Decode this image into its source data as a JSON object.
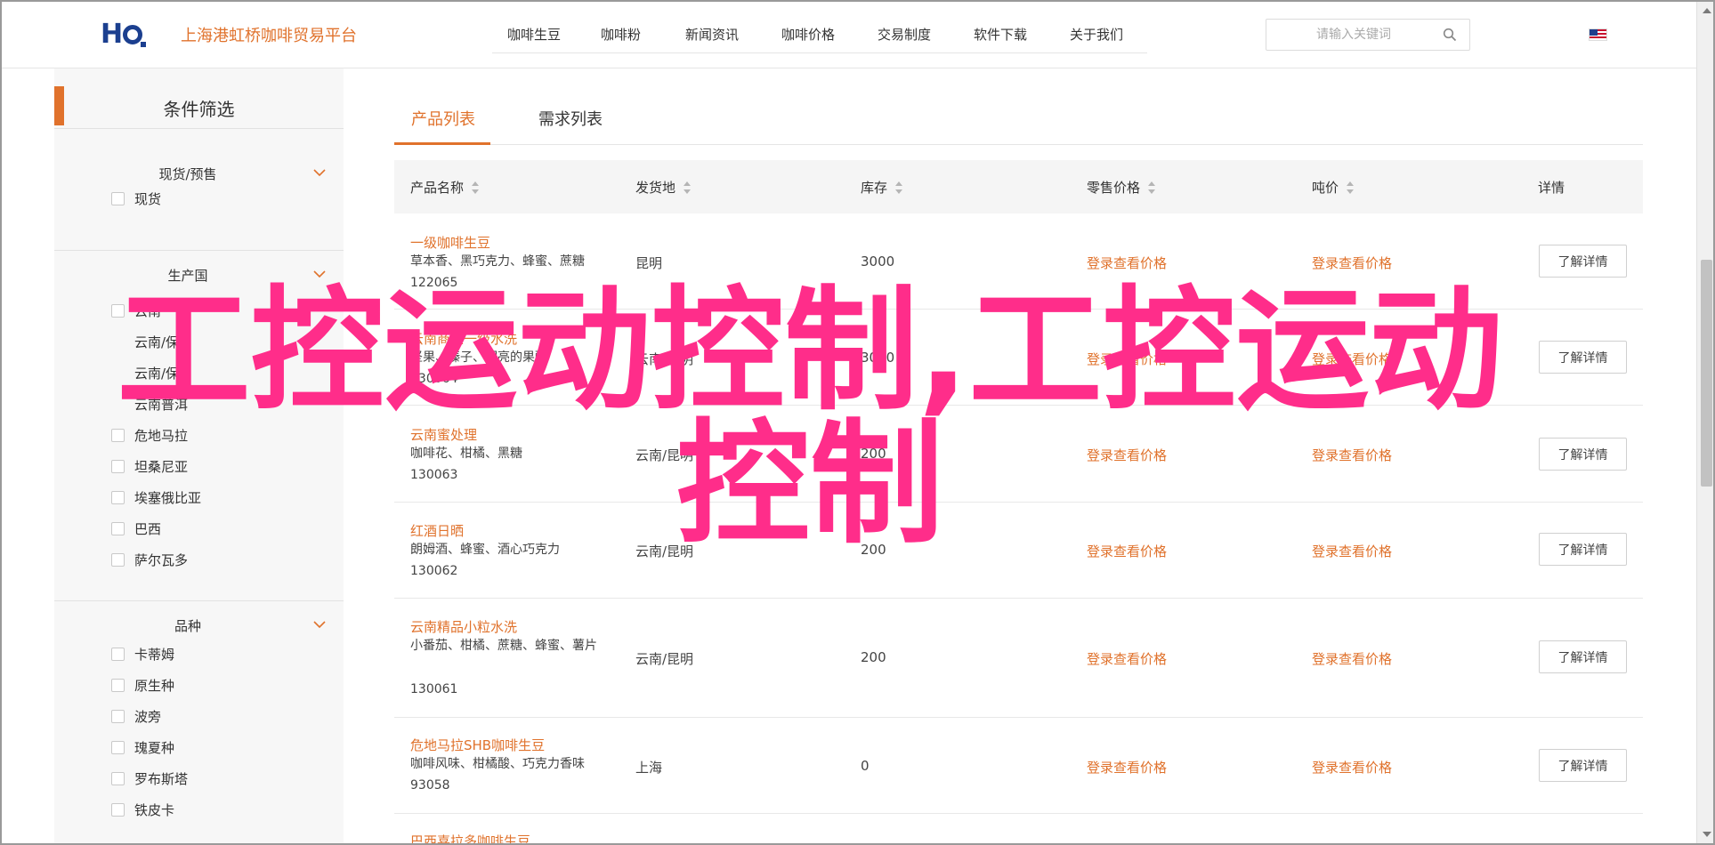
{
  "header": {
    "site_name": "上海港虹桥咖啡贸易平台",
    "nav": [
      "咖啡生豆",
      "咖啡粉",
      "新闻资讯",
      "咖啡价格",
      "交易制度",
      "软件下载",
      "关于我们"
    ],
    "search_placeholder": "请输入关键词"
  },
  "sidebar": {
    "title": "条件筛选",
    "groups": [
      {
        "title": "现货/预售",
        "options": [
          "现货"
        ]
      },
      {
        "title": "生产国",
        "options": [
          "云南",
          "云南/保山",
          "云南/保山",
          "云南普洱",
          "危地马拉",
          "坦桑尼亚",
          "埃塞俄比亚",
          "巴西",
          "萨尔瓦多"
        ]
      },
      {
        "title": "品种",
        "options": [
          "卡蒂姆",
          "原生种",
          "波旁",
          "瑰夏种",
          "罗布斯塔",
          "铁皮卡"
        ]
      }
    ]
  },
  "tabs": {
    "products": "产品列表",
    "demands": "需求列表"
  },
  "table": {
    "headers": [
      "产品名称",
      "发货地",
      "库存",
      "零售价格",
      "吨价",
      "详情"
    ],
    "rows": [
      {
        "name": "一级咖啡生豆",
        "desc": "草本香、黑巧克力、蜂蜜、蔗糖",
        "code": "122065",
        "origin": "昆明",
        "stock": "3000",
        "retail": "登录查看价格",
        "ton": "登录查看价格",
        "detail": "了解详情"
      },
      {
        "name": "云南商业一级水洗",
        "desc": "坚果、榛子、明亮的果酸",
        "code": "130064",
        "origin": "云南/昆明",
        "stock": "3000",
        "retail": "登录查看价格",
        "ton": "登录查看价格",
        "detail": "了解详情"
      },
      {
        "name": "云南蜜处理",
        "desc": "咖啡花、柑橘、黑糖",
        "code": "130063",
        "origin": "云南/昆明",
        "stock": "200",
        "retail": "登录查看价格",
        "ton": "登录查看价格",
        "detail": "了解详情"
      },
      {
        "name": "红酒日晒",
        "desc": "朗姆酒、蜂蜜、酒心巧克力",
        "code": "130062",
        "origin": "云南/昆明",
        "stock": "200",
        "retail": "登录查看价格",
        "ton": "登录查看价格",
        "detail": "了解详情"
      },
      {
        "name": "云南精品小粒水洗",
        "desc": "小番茄、柑橘、蔗糖、蜂蜜、薯片",
        "code": "130061",
        "origin": "云南/昆明",
        "stock": "200",
        "retail": "登录查看价格",
        "ton": "登录查看价格",
        "detail": "了解详情"
      },
      {
        "name": "危地马拉SHB咖啡生豆",
        "desc": "咖啡风味、柑橘酸、巧克力香味",
        "code": "93058",
        "origin": "上海",
        "stock": "0",
        "retail": "登录查看价格",
        "ton": "登录查看价格",
        "detail": "了解详情"
      },
      {
        "name": "巴西喜拉多咖啡生豆",
        "desc": "",
        "code": "",
        "origin": "",
        "stock": "",
        "retail": "",
        "ton": "",
        "detail": ""
      }
    ]
  },
  "watermark": {
    "line1": "工控运动控制,工控运动",
    "line2": "控制"
  },
  "colors": {
    "accent": "#e0722c",
    "watermark": "#ff2d8a",
    "logo": "#1b3f8f"
  },
  "icons": {
    "search": "search-icon",
    "chevron": "chevron-down-icon",
    "flag": "us-flag-icon"
  }
}
